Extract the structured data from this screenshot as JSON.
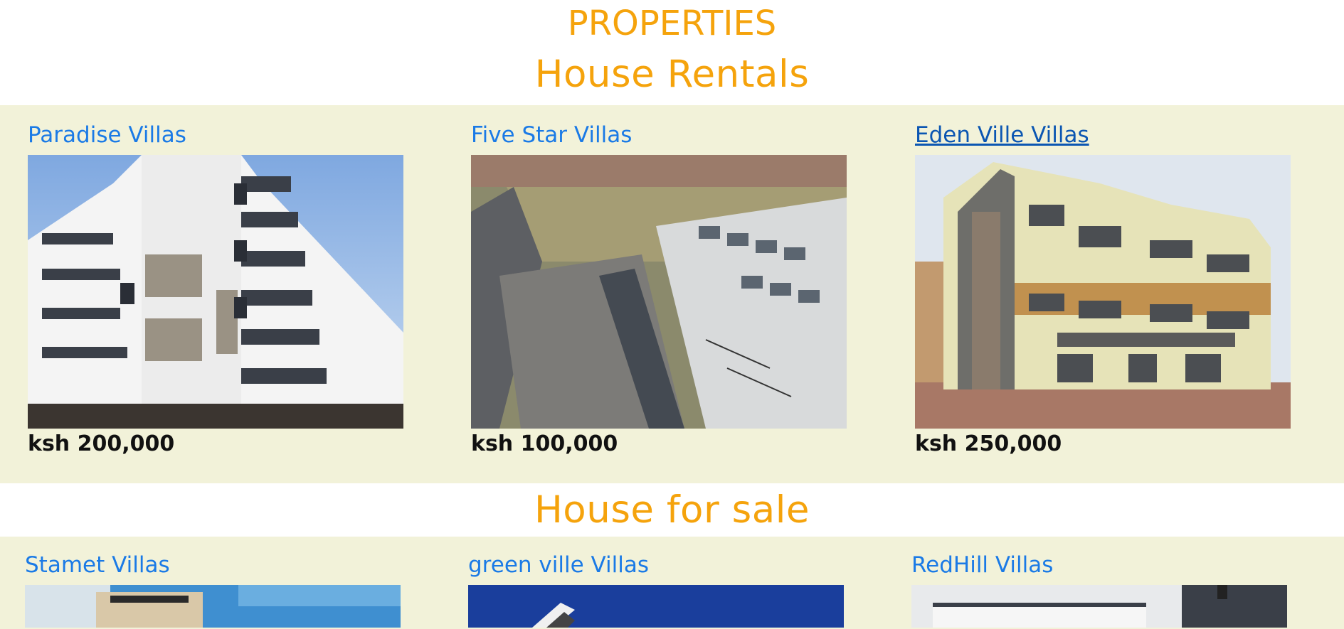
{
  "page": {
    "title": "PROPERTIES"
  },
  "rentals": {
    "heading": "House Rentals",
    "listings": [
      {
        "name": "Paradise Villas",
        "price": "ksh 200,000"
      },
      {
        "name": "Five Star Villas",
        "price": "ksh 100,000"
      },
      {
        "name": "Eden Ville Villas",
        "price": "ksh 250,000"
      }
    ]
  },
  "sale": {
    "heading": "House for sale",
    "listings": [
      {
        "name": "Stamet Villas"
      },
      {
        "name": "green ville Villas"
      },
      {
        "name": "RedHill Villas"
      }
    ]
  },
  "colors": {
    "heading": "#f5a30c",
    "link": "#1a7ae6",
    "band": "#f2f2d9"
  }
}
